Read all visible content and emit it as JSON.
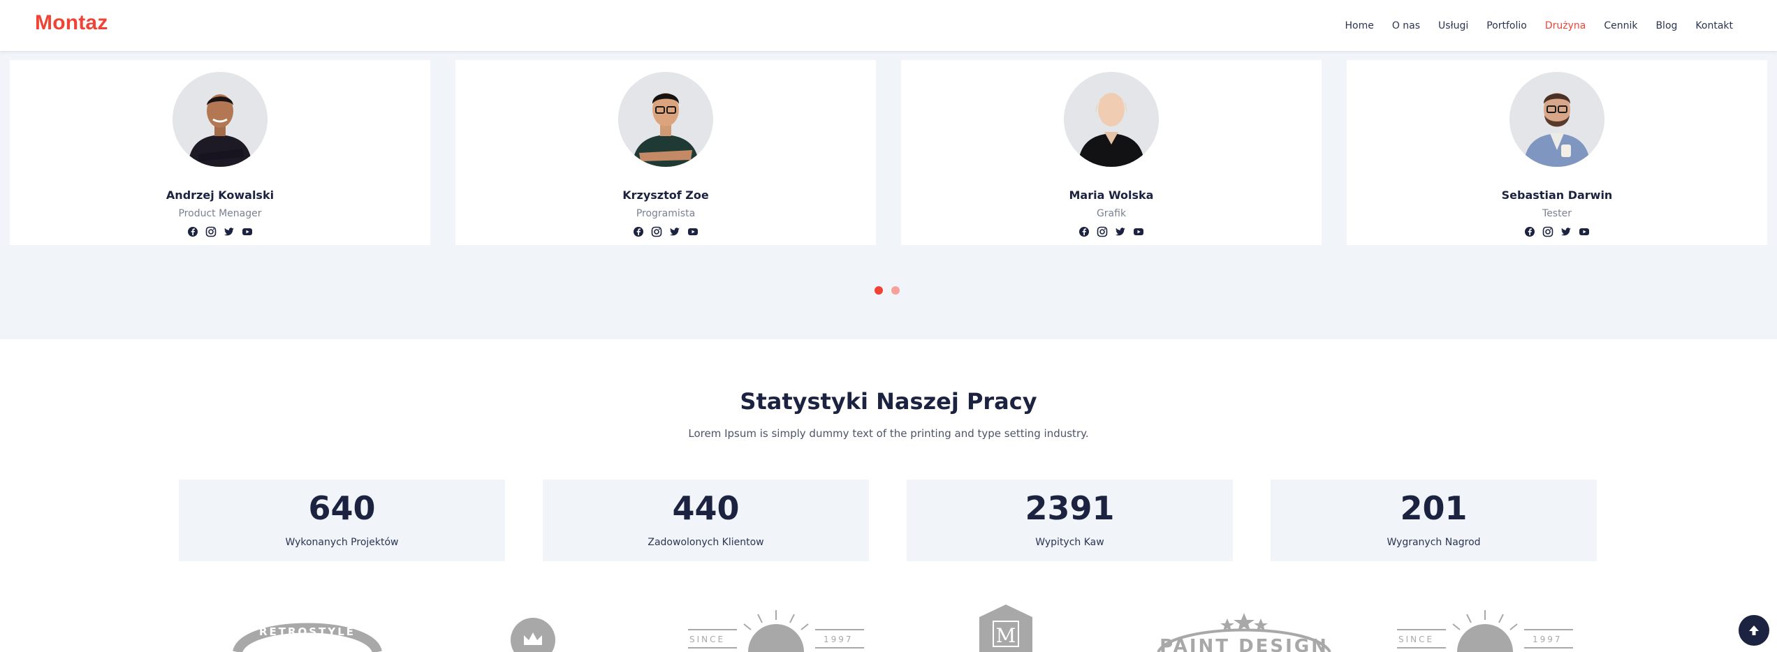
{
  "brand": {
    "name": "Montaz",
    "accent": "#f04336",
    "dark": "#1c2340"
  },
  "nav": {
    "items": [
      {
        "label": "Home",
        "active": false
      },
      {
        "label": "O nas",
        "active": false
      },
      {
        "label": "Usługi",
        "active": false
      },
      {
        "label": "Portfolio",
        "active": false
      },
      {
        "label": "Drużyna",
        "active": true
      },
      {
        "label": "Cennik",
        "active": false
      },
      {
        "label": "Blog",
        "active": false
      },
      {
        "label": "Kontakt",
        "active": false
      }
    ]
  },
  "team": {
    "members": [
      {
        "name": "Andrzej Kowalski",
        "role": "Product Menager"
      },
      {
        "name": "Krzysztof Zoe",
        "role": "Programista"
      },
      {
        "name": "Maria Wolska",
        "role": "Grafik"
      },
      {
        "name": "Sebastian Darwin",
        "role": "Tester"
      }
    ],
    "social_icons": [
      "facebook-icon",
      "instagram-icon",
      "twitter-icon",
      "youtube-icon"
    ],
    "carousel": {
      "pages": 2,
      "active_page": 1
    }
  },
  "stats": {
    "title": "Statystyki Naszej Pracy",
    "subtitle": "Lorem Ipsum is simply dummy text of the printing and type setting industry.",
    "items": [
      {
        "value": "640",
        "label": "Wykonanych Projektów"
      },
      {
        "value": "440",
        "label": "Zadowolonych Klientow"
      },
      {
        "value": "2391",
        "label": "Wypitych Kaw"
      },
      {
        "value": "201",
        "label": "Wygranych Nagrod"
      }
    ]
  },
  "partner_logos": {
    "retrostyle": "RETROSTYLE",
    "since_1": "SINCE",
    "year_1": "1997",
    "since_2": "SINCE",
    "year_2": "1997",
    "m_badge": "M",
    "paint": "PAINT DESIGN"
  }
}
